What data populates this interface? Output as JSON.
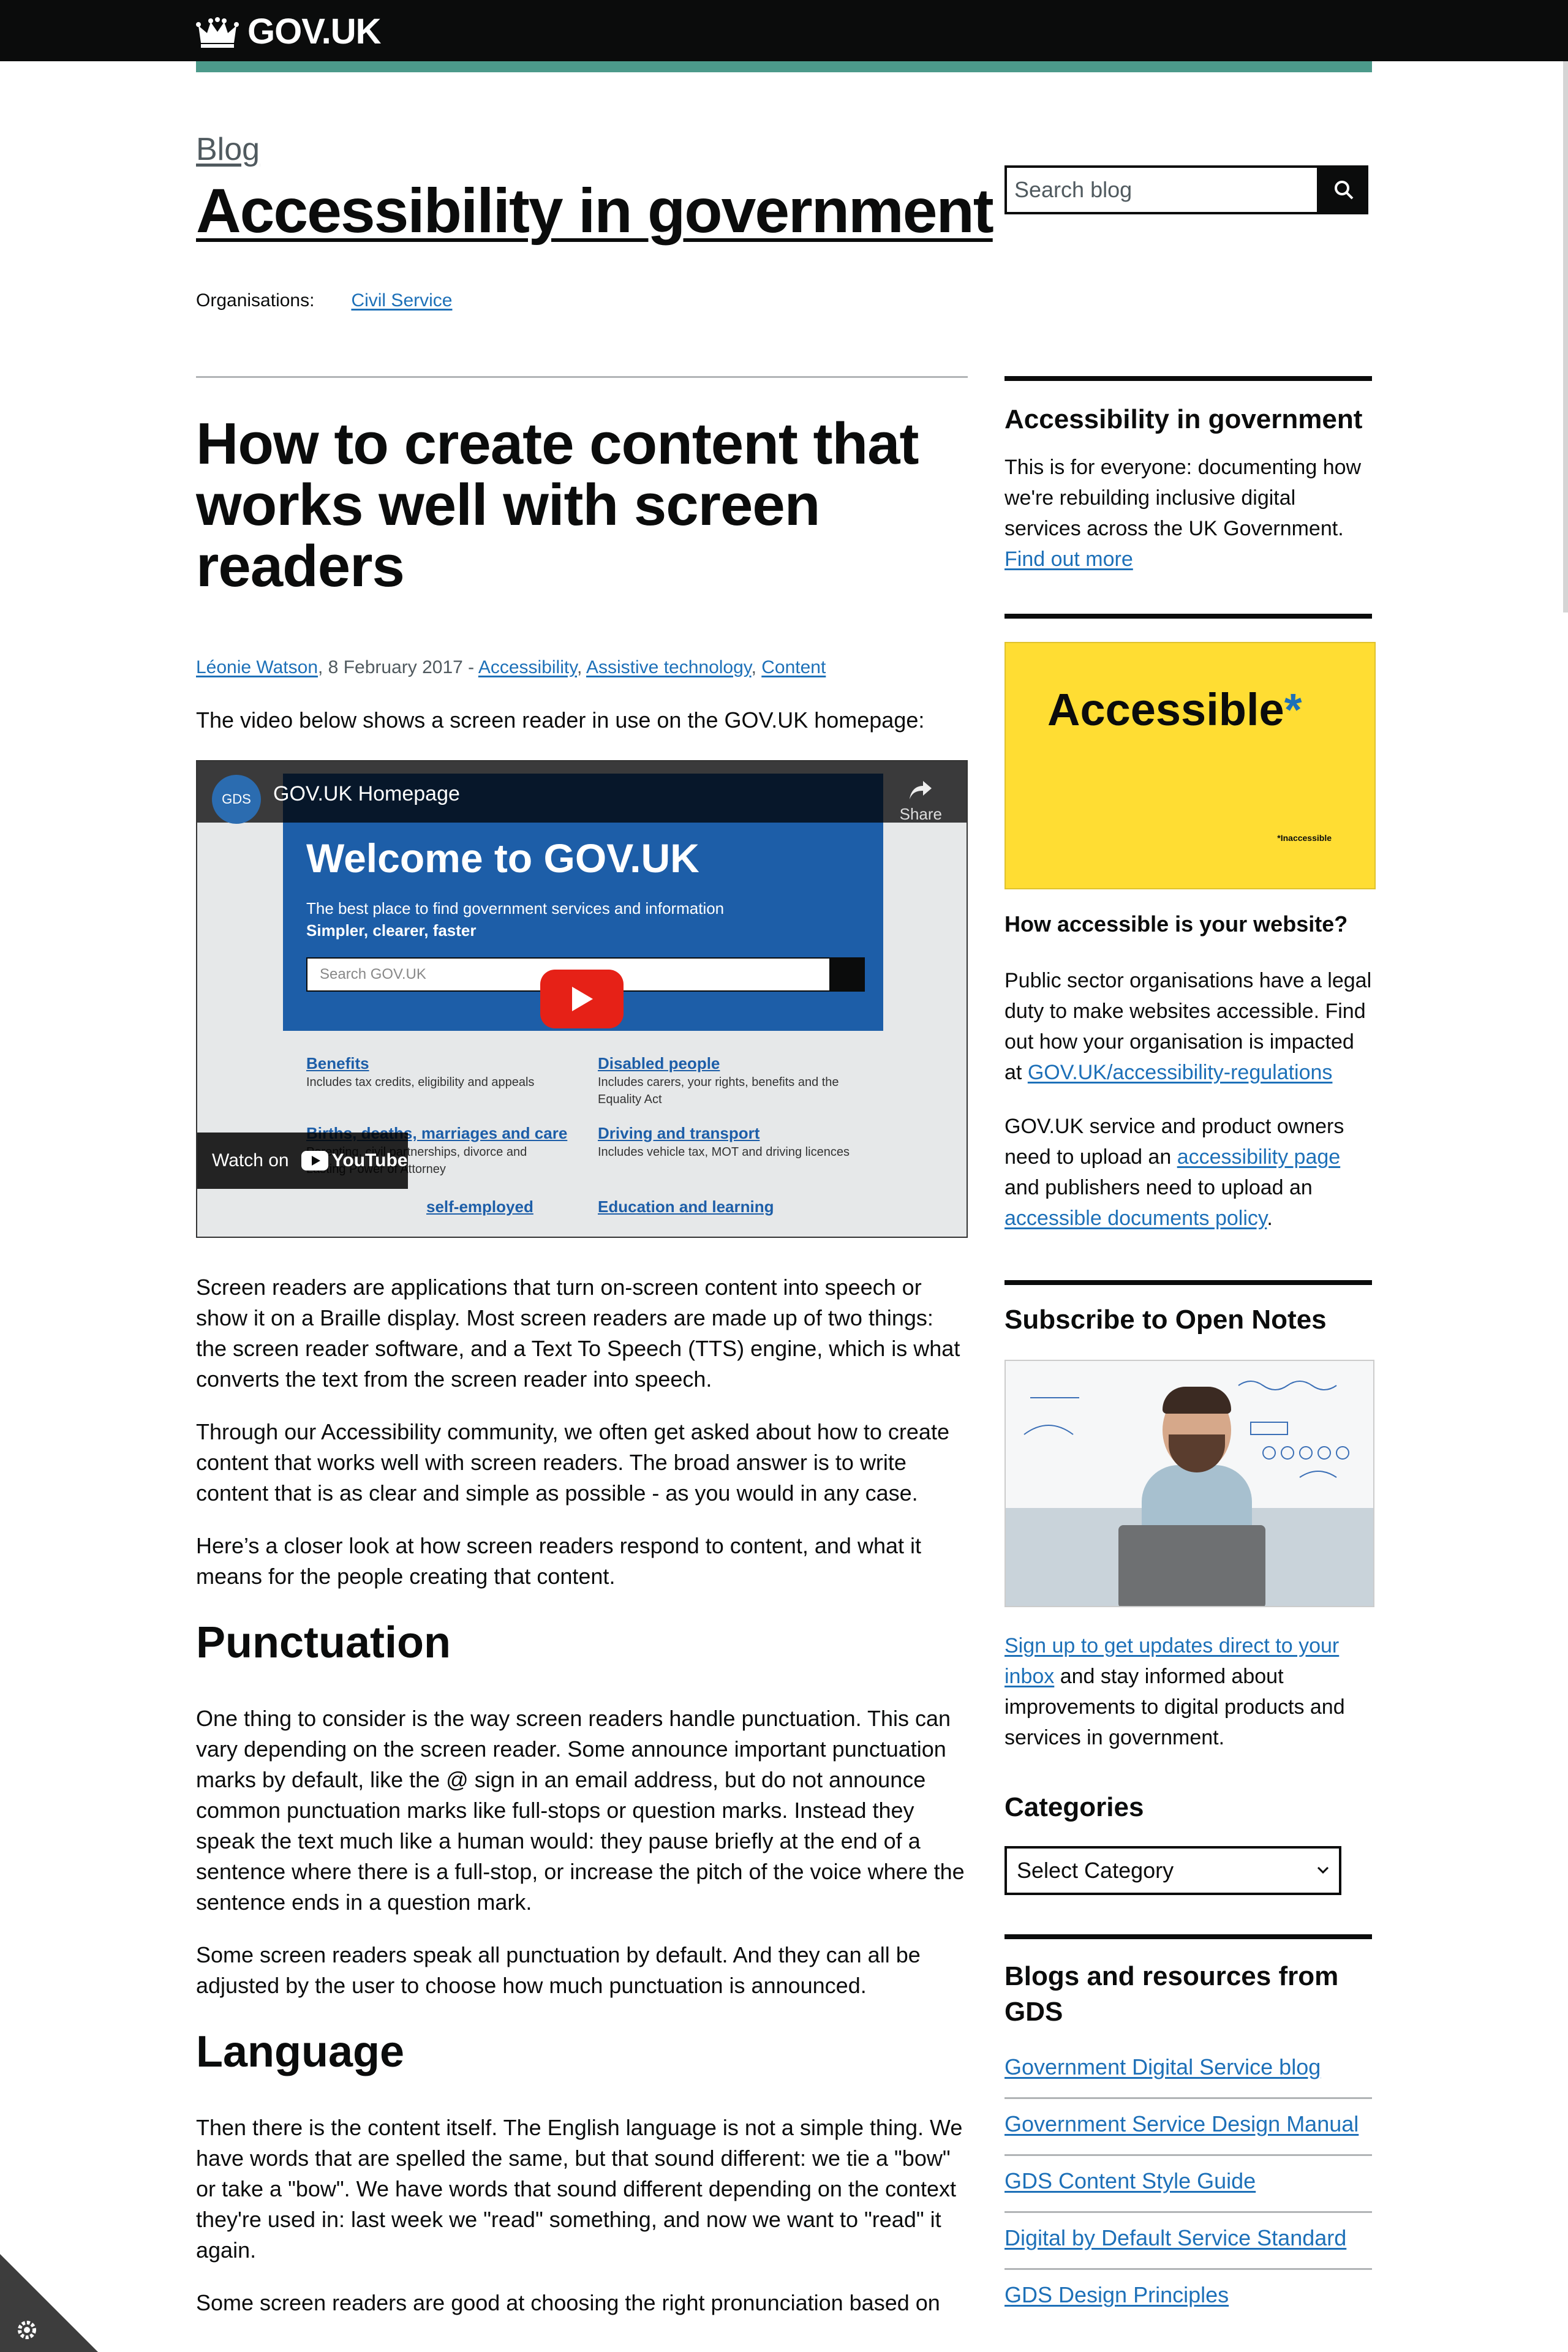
{
  "header": {
    "logo_text": "GOV.UK"
  },
  "blog": {
    "link_label": "Blog",
    "title": "Accessibility in government",
    "organisations_label": "Organisations:",
    "organisation": "Civil Service"
  },
  "search": {
    "placeholder": "Search blog"
  },
  "article": {
    "title": "How to create content that works well with screen readers",
    "author": "Léonie Watson",
    "date": ", 8 February 2017 - ",
    "categories": [
      "Accessibility",
      "Assistive technology",
      "Content"
    ],
    "intro": "The video below shows a screen reader in use on the GOV.UK homepage:",
    "paragraphs": [
      "Screen readers are applications that turn on-screen content into speech or show it on a Braille display. Most screen readers are made up of two things: the screen reader software, and a Text To Speech (TTS) engine, which is what converts the text from the screen reader into speech.",
      "Through our Accessibility community, we often get asked about how to create content that works well with screen readers. The broad answer is to write content that is as clear and simple as possible - as you would in any case.",
      "Here’s a closer look at how screen readers respond to content, and what it means for the people creating that content."
    ],
    "section1_heading": "Punctuation",
    "section1_paragraphs": [
      "One thing to consider is the way screen readers handle punctuation. This can vary depending on the screen reader. Some announce important punctuation marks by default, like the @ sign in an email address, but do not announce common punctuation marks like full-stops or question marks. Instead they speak the text much like a human would: they pause briefly at the end of a sentence where there is a full-stop, or increase the pitch of the voice where the sentence ends in a question mark.",
      "Some screen readers speak all punctuation by default. And they can all be adjusted by the user to choose how much punctuation is announced."
    ],
    "section2_heading": "Language",
    "section2_paragraphs": [
      "Then there is the content itself. The English language is not a simple thing. We have words that are spelled the same, but that sound different: we tie a \"bow\" or take a \"bow\". We have words that sound different depending on the context they're used in: last week we \"read\" something, and now we want to \"read\" it again.",
      "Some screen readers are good at choosing the right pronunciation based on"
    ]
  },
  "video": {
    "channel_badge": "GDS",
    "title": "GOV.UK Homepage",
    "share_label": "Share",
    "welcome": "Welcome to GOV.UK",
    "tagline_1": "The best place to find government services and information",
    "tagline_2": "Simpler, clearer, faster",
    "search_placeholder": "Search GOV.UK",
    "links": [
      {
        "title": "Benefits",
        "desc": "Includes tax credits, eligibility and appeals"
      },
      {
        "title": "Disabled people",
        "desc": "Includes carers, your rights, benefits and the Equality Act"
      },
      {
        "title": "Births, deaths, marriages and care",
        "desc": "Parenting, civil partnerships, divorce and Lasting Power of Attorney"
      },
      {
        "title": "Driving and transport",
        "desc": "Includes vehicle tax, MOT and driving licences"
      },
      {
        "title": "self-employed",
        "desc": ""
      },
      {
        "title": "Education and learning",
        "desc": ""
      }
    ],
    "watch_on": "Watch on",
    "youtube": "YouTube"
  },
  "sidebar": {
    "about_heading": "Accessibility in government",
    "about_text": "This is for everyone: documenting how we're rebuilding inclusive digital services across the UK Government.",
    "about_link": "Find out more",
    "banner_word": "Accessible",
    "banner_star": "*",
    "banner_footnote": "*Inaccessible",
    "question_heading": "How accessible is your website?",
    "question_p1_text": "Public sector organisations have a legal duty to make websites accessible. Find out how your organisation is impacted at ",
    "question_p1_link": "GOV.UK/accessibility-regulations",
    "question_p2_a": "GOV.UK service and product owners need to upload an ",
    "question_p2_link1": "accessibility page",
    "question_p2_b": " and publishers need to upload an ",
    "question_p2_link2": "accessible documents policy",
    "question_p2_c": ".",
    "subscribe_heading": "Subscribe to Open Notes",
    "subscribe_link": "Sign up to get updates direct to your inbox",
    "subscribe_text": " and stay informed about improvements to digital products and services in government.",
    "categories_heading": "Categories",
    "categories_select": "Select Category",
    "resources_heading": "Blogs and resources from GDS",
    "resources": [
      "Government Digital Service blog",
      "Government Service Design Manual",
      "GDS Content Style Guide",
      "Digital by Default Service Standard",
      "GDS Design Principles"
    ]
  },
  "colors": {
    "header_bg": "#0b0c0c",
    "accent_teal": "#4c9a8b",
    "link": "#1d70b8",
    "banner_yellow": "#ffdd33",
    "play_red": "#e62117"
  }
}
